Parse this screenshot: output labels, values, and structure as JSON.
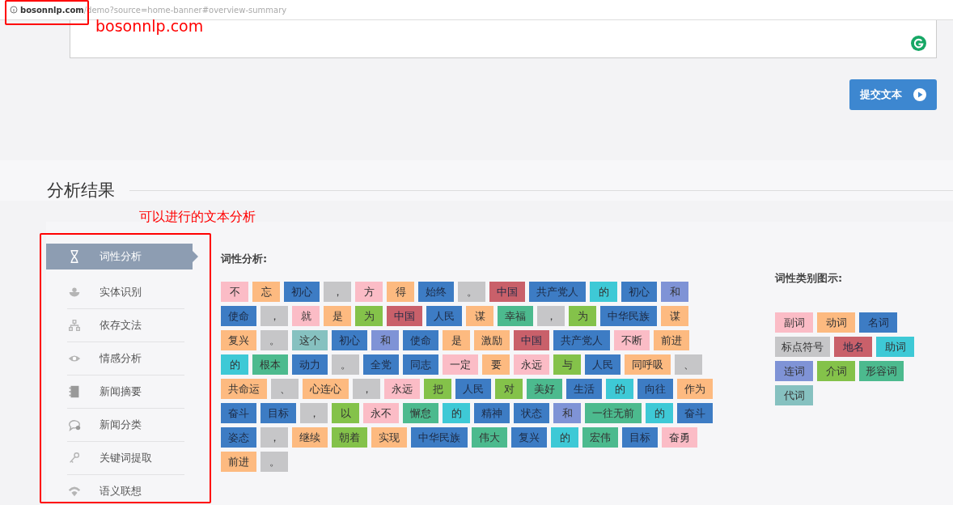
{
  "address_bar": {
    "domain": "bosonnlp.com",
    "path": "/demo?source=home-banner#overview-summary"
  },
  "submit_button": {
    "label": "提交文本"
  },
  "section_title": "分析结果",
  "annotations": [
    {
      "kind": "url",
      "text": "bosonnlp.com"
    },
    {
      "kind": "sidebar",
      "text": "可以进行的文本分析"
    }
  ],
  "sidebar": {
    "items": [
      {
        "label": "词性分析",
        "selected": true
      },
      {
        "label": "实体识别",
        "selected": false
      },
      {
        "label": "依存文法",
        "selected": false
      },
      {
        "label": "情感分析",
        "selected": false
      },
      {
        "label": "新闻摘要",
        "selected": false
      },
      {
        "label": "新闻分类",
        "selected": false
      },
      {
        "label": "关键词提取",
        "selected": false
      },
      {
        "label": "语义联想",
        "selected": false
      }
    ]
  },
  "result": {
    "title": "词性分析:",
    "lines": [
      [
        {
          "text": "不",
          "kind": "adv"
        },
        {
          "text": "忘",
          "kind": "verb"
        },
        {
          "text": "初心",
          "kind": "noun"
        },
        {
          "text": "，",
          "kind": "punct"
        },
        {
          "text": "方",
          "kind": "adv"
        },
        {
          "text": "得",
          "kind": "verb"
        },
        {
          "text": "始终",
          "kind": "noun"
        },
        {
          "text": "。",
          "kind": "punct"
        },
        {
          "text": "中国",
          "kind": "place"
        },
        {
          "text": "共产党人",
          "kind": "noun"
        },
        {
          "text": "的",
          "kind": "aux"
        },
        {
          "text": "初心",
          "kind": "noun"
        },
        {
          "text": "和",
          "kind": "conj"
        }
      ],
      [
        {
          "text": "使命",
          "kind": "noun"
        },
        {
          "text": "，",
          "kind": "punct"
        },
        {
          "text": "就",
          "kind": "adv"
        },
        {
          "text": "是",
          "kind": "verb"
        },
        {
          "text": "为",
          "kind": "prep"
        },
        {
          "text": "中国",
          "kind": "place"
        },
        {
          "text": "人民",
          "kind": "noun"
        },
        {
          "text": "谋",
          "kind": "verb"
        },
        {
          "text": "幸福",
          "kind": "adj"
        },
        {
          "text": "，",
          "kind": "punct"
        },
        {
          "text": "为",
          "kind": "prep"
        },
        {
          "text": "中华民族",
          "kind": "noun"
        },
        {
          "text": "谋",
          "kind": "verb"
        }
      ],
      [
        {
          "text": "复兴",
          "kind": "verb"
        },
        {
          "text": "。",
          "kind": "punct"
        },
        {
          "text": "这个",
          "kind": "pron"
        },
        {
          "text": "初心",
          "kind": "noun"
        },
        {
          "text": "和",
          "kind": "conj"
        },
        {
          "text": "使命",
          "kind": "noun"
        },
        {
          "text": "是",
          "kind": "verb"
        },
        {
          "text": "激励",
          "kind": "verb"
        },
        {
          "text": "中国",
          "kind": "place"
        },
        {
          "text": "共产党人",
          "kind": "noun"
        },
        {
          "text": "不断",
          "kind": "adv"
        },
        {
          "text": "前进",
          "kind": "verb"
        }
      ],
      [
        {
          "text": "的",
          "kind": "aux"
        },
        {
          "text": "根本",
          "kind": "adj"
        },
        {
          "text": "动力",
          "kind": "noun"
        },
        {
          "text": "。",
          "kind": "punct"
        },
        {
          "text": "全党",
          "kind": "noun"
        },
        {
          "text": "同志",
          "kind": "noun"
        },
        {
          "text": "一定",
          "kind": "adv"
        },
        {
          "text": "要",
          "kind": "verb"
        },
        {
          "text": "永远",
          "kind": "adv"
        },
        {
          "text": "与",
          "kind": "prep"
        },
        {
          "text": "人民",
          "kind": "noun"
        },
        {
          "text": "同呼吸",
          "kind": "verb"
        },
        {
          "text": "、",
          "kind": "punct"
        }
      ],
      [
        {
          "text": "共命运",
          "kind": "verb"
        },
        {
          "text": "、",
          "kind": "punct"
        },
        {
          "text": "心连心",
          "kind": "verb"
        },
        {
          "text": "，",
          "kind": "punct"
        },
        {
          "text": "永远",
          "kind": "adv"
        },
        {
          "text": "把",
          "kind": "prep"
        },
        {
          "text": "人民",
          "kind": "noun"
        },
        {
          "text": "对",
          "kind": "prep"
        },
        {
          "text": "美好",
          "kind": "adj"
        },
        {
          "text": "生活",
          "kind": "noun"
        },
        {
          "text": "的",
          "kind": "aux"
        },
        {
          "text": "向往",
          "kind": "noun"
        },
        {
          "text": "作为",
          "kind": "verb"
        }
      ],
      [
        {
          "text": "奋斗",
          "kind": "noun"
        },
        {
          "text": "目标",
          "kind": "noun"
        },
        {
          "text": "，",
          "kind": "punct"
        },
        {
          "text": "以",
          "kind": "prep"
        },
        {
          "text": "永不",
          "kind": "adv"
        },
        {
          "text": "懈怠",
          "kind": "adj"
        },
        {
          "text": "的",
          "kind": "aux"
        },
        {
          "text": "精神",
          "kind": "noun"
        },
        {
          "text": "状态",
          "kind": "noun"
        },
        {
          "text": "和",
          "kind": "conj"
        },
        {
          "text": "一往无前",
          "kind": "adj"
        },
        {
          "text": "的",
          "kind": "aux"
        },
        {
          "text": "奋斗",
          "kind": "noun"
        }
      ],
      [
        {
          "text": "姿态",
          "kind": "noun"
        },
        {
          "text": "，",
          "kind": "punct"
        },
        {
          "text": "继续",
          "kind": "verb"
        },
        {
          "text": "朝着",
          "kind": "prep"
        },
        {
          "text": "实现",
          "kind": "verb"
        },
        {
          "text": "中华民族",
          "kind": "noun"
        },
        {
          "text": "伟大",
          "kind": "adj"
        },
        {
          "text": "复兴",
          "kind": "noun"
        },
        {
          "text": "的",
          "kind": "aux"
        },
        {
          "text": "宏伟",
          "kind": "adj"
        },
        {
          "text": "目标",
          "kind": "noun"
        },
        {
          "text": "奋勇",
          "kind": "adv"
        }
      ],
      [
        {
          "text": "前进",
          "kind": "verb"
        },
        {
          "text": "。",
          "kind": "punct"
        }
      ]
    ]
  },
  "legend": {
    "title": "词性类别图示:",
    "items": [
      {
        "text": "副词",
        "kind": "adv"
      },
      {
        "text": "动词",
        "kind": "verb"
      },
      {
        "text": "名词",
        "kind": "noun"
      },
      {
        "text": "标点符号",
        "kind": "punct"
      },
      {
        "text": "地名",
        "kind": "place"
      },
      {
        "text": "助词",
        "kind": "aux"
      },
      {
        "text": "连词",
        "kind": "conj"
      },
      {
        "text": "介词",
        "kind": "prep"
      },
      {
        "text": "形容词",
        "kind": "adj"
      },
      {
        "text": "代词",
        "kind": "pron"
      }
    ]
  }
}
